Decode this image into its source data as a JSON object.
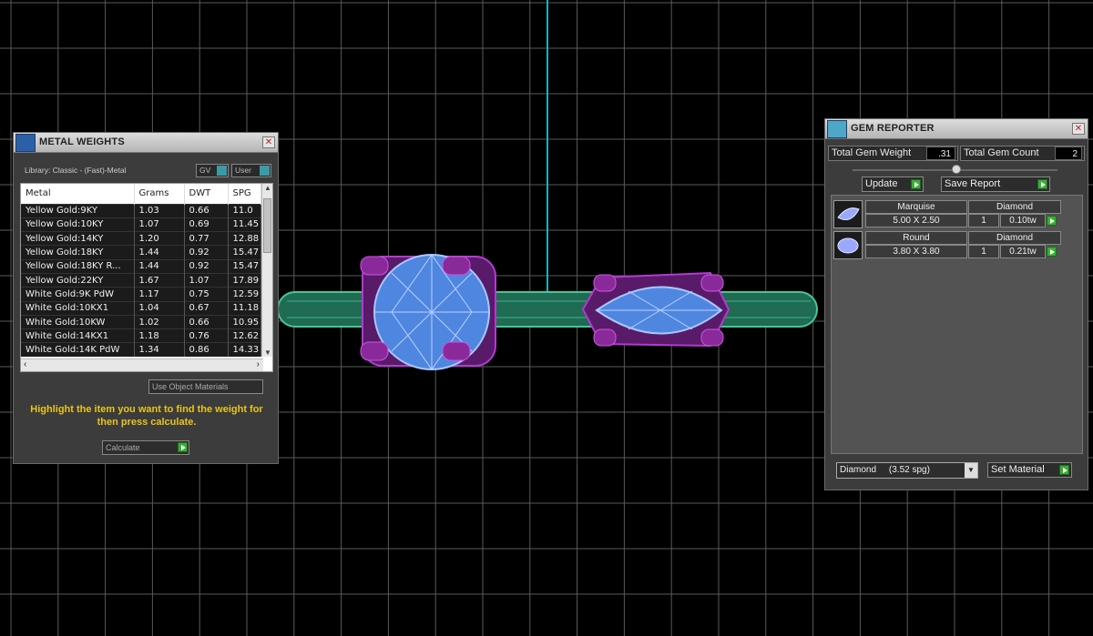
{
  "metal_weights": {
    "title": "METAL WEIGHTS",
    "library": "Library: Classic - (Fast)-Metal",
    "gv_label": "GV",
    "user_label": "User",
    "columns": [
      "Metal",
      "Grams",
      "DWT",
      "SPG"
    ],
    "rows": [
      [
        "Yellow Gold:9KY",
        "1.03",
        "0.66",
        "11.0"
      ],
      [
        "Yellow Gold:10KY",
        "1.07",
        "0.69",
        "11.45"
      ],
      [
        "Yellow Gold:14KY",
        "1.20",
        "0.77",
        "12.88"
      ],
      [
        "Yellow Gold:18KY",
        "1.44",
        "0.92",
        "15.47"
      ],
      [
        "Yellow Gold:18KY R...",
        "1.44",
        "0.92",
        "15.47"
      ],
      [
        "Yellow Gold:22KY",
        "1.67",
        "1.07",
        "17.89"
      ],
      [
        "White Gold:9K PdW",
        "1.17",
        "0.75",
        "12.59"
      ],
      [
        "White Gold:10KX1",
        "1.04",
        "0.67",
        "11.18"
      ],
      [
        "White Gold:10KW",
        "1.02",
        "0.66",
        "10.95"
      ],
      [
        "White Gold:14KX1",
        "1.18",
        "0.76",
        "12.62"
      ],
      [
        "White Gold:14K PdW",
        "1.34",
        "0.86",
        "14.33"
      ]
    ],
    "use_object_materials": "Use Object Materials",
    "message": "Highlight the item you want to find the weight for then press calculate.",
    "calculate_label": "Calculate"
  },
  "gem_reporter": {
    "title": "GEM REPORTER",
    "total_weight_label": "Total Gem Weight",
    "total_weight_value": ".31",
    "total_count_label": "Total Gem Count",
    "total_count_value": "2",
    "update_label": "Update",
    "save_report_label": "Save Report",
    "gems": [
      {
        "shape": "Marquise",
        "material": "Diamond",
        "size": "5.00 X 2.50",
        "qty": "1",
        "weight": "0.10tw"
      },
      {
        "shape": "Round",
        "material": "Diamond",
        "size": "3.80 X 3.80",
        "qty": "1",
        "weight": "0.21tw"
      }
    ],
    "material_select": "Diamond     (3.52 spg)",
    "set_material_label": "Set Material"
  },
  "colors": {
    "background": "#000000",
    "grid": "#5a5a5a",
    "axis": "#2aa9b8",
    "band": "#2f8a6a",
    "prongs": "#8a2a9a",
    "gem": "#5a8ee8",
    "accent_yellow": "#e9c41c",
    "go_green": "#37b035"
  }
}
